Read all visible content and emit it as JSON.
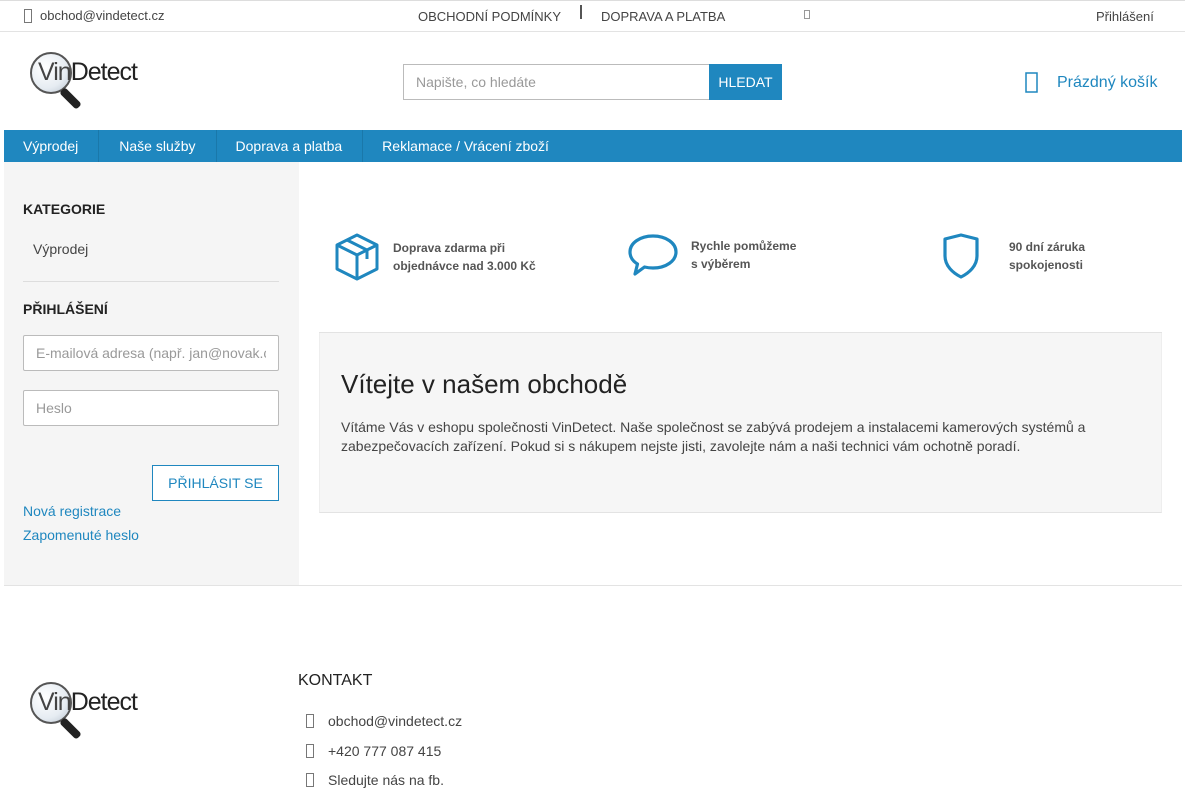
{
  "topbar": {
    "email": "obchod@vindetect.cz",
    "links": [
      "OBCHODNÍ PODMÍNKY",
      "DOPRAVA A PLATBA"
    ],
    "login": "Přihlášení"
  },
  "header": {
    "logo_text_prefix": "Vin",
    "logo_text_suffix": "Detect",
    "search_placeholder": "Napište, co hledáte",
    "search_button": "HLEDAT",
    "cart_label": "Prázdný košík"
  },
  "nav": {
    "items": [
      "Výprodej",
      "Naše služby",
      "Doprava a platba",
      "Reklamace / Vrácení zboží"
    ]
  },
  "sidebar": {
    "categories_title": "KATEGORIE",
    "categories": [
      "Výprodej"
    ],
    "login_title": "PŘIHLÁŠENÍ",
    "email_placeholder": "E-mailová adresa (např. jan@novak.cz)",
    "password_placeholder": "Heslo",
    "login_button": "PŘIHLÁSIT SE",
    "register_link": "Nová registrace",
    "forgot_link": "Zapomenuté heslo"
  },
  "benefits": [
    {
      "icon": "box-icon",
      "line1": "Doprava zdarma při",
      "line2": "objednávce nad 3.000 Kč"
    },
    {
      "icon": "chat-bubble-icon",
      "line1": "Rychle pomůžeme",
      "line2": "s výběrem"
    },
    {
      "icon": "shield-icon",
      "line1": "90 dní záruka",
      "line2": "spokojenosti"
    }
  ],
  "welcome": {
    "title": "Vítejte v našem obchodě",
    "text": "Vítáme Vás v eshopu společnosti VinDetect. Naše společnost se zabývá prodejem a instalacemi kamerových systémů a zabezpečovacích zařízení. Pokud si s nákupem nejste jisti, zavolejte nám a naši technici vám ochotně poradí."
  },
  "footer": {
    "contact_title": "KONTAKT",
    "email": "obchod@vindetect.cz",
    "phone": "+420 777 087 415",
    "facebook": "Sledujte nás na fb."
  },
  "colors": {
    "accent": "#1f87bf",
    "sidebar_bg": "#f5f5f5",
    "benefit_icon": "#1f87bf"
  }
}
